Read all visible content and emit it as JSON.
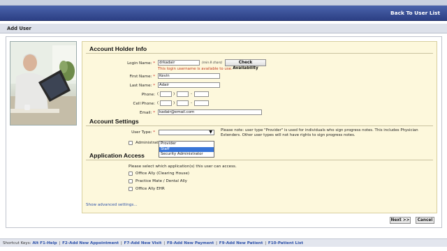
{
  "nav": {
    "back_label": "Back To User List"
  },
  "section": {
    "title": "Add User"
  },
  "account_info": {
    "heading": "Account Holder Info",
    "login_label": "Login Name:",
    "login_value": "drkadair",
    "login_hint": "(min 8 chars)",
    "check_button": "Check Availability",
    "availability_msg": "This login username is available to use.",
    "first_label": "First Name:",
    "first_value": "Kevin",
    "last_label": "Last Name:",
    "last_value": "Adair",
    "phone_label": "Phone:",
    "cell_label": "Cell Phone:",
    "email_label": "Email:",
    "email_value": "kadair@email.com",
    "required_mark": "*",
    "paren_open": "(",
    "paren_close": ")",
    "dash": "-"
  },
  "account_settings": {
    "heading": "Account Settings",
    "user_type_label": "User Type:",
    "arrow": "▼",
    "options": [
      "Provider",
      "Staff",
      "Security Administrator"
    ],
    "admin_label": "Administrati",
    "note": "Please note: user type \"Provider\" is used for individuals who sign progress notes. This includes Physician Extenders. Other user types will not have rights to sign progress notes."
  },
  "app_access": {
    "heading": "Application Access",
    "intro": "Please select which application(s) this user can access.",
    "apps": [
      "Office Ally (Clearing House)",
      "Practice Mate / Dental Ally",
      "Office Ally EHR"
    ]
  },
  "advanced_link": "Show advanced settings...",
  "actions": {
    "next": "Next >>",
    "cancel": "Cancel"
  },
  "footer": {
    "prefix": "Shortcut Keys:",
    "keys": [
      "Alt F1-Help",
      "F2-Add New Appointment",
      "F7-Add New Visit",
      "F8-Add New Payment",
      "F9-Add New Patient",
      "F10-Patient List"
    ],
    "separator": "|"
  }
}
